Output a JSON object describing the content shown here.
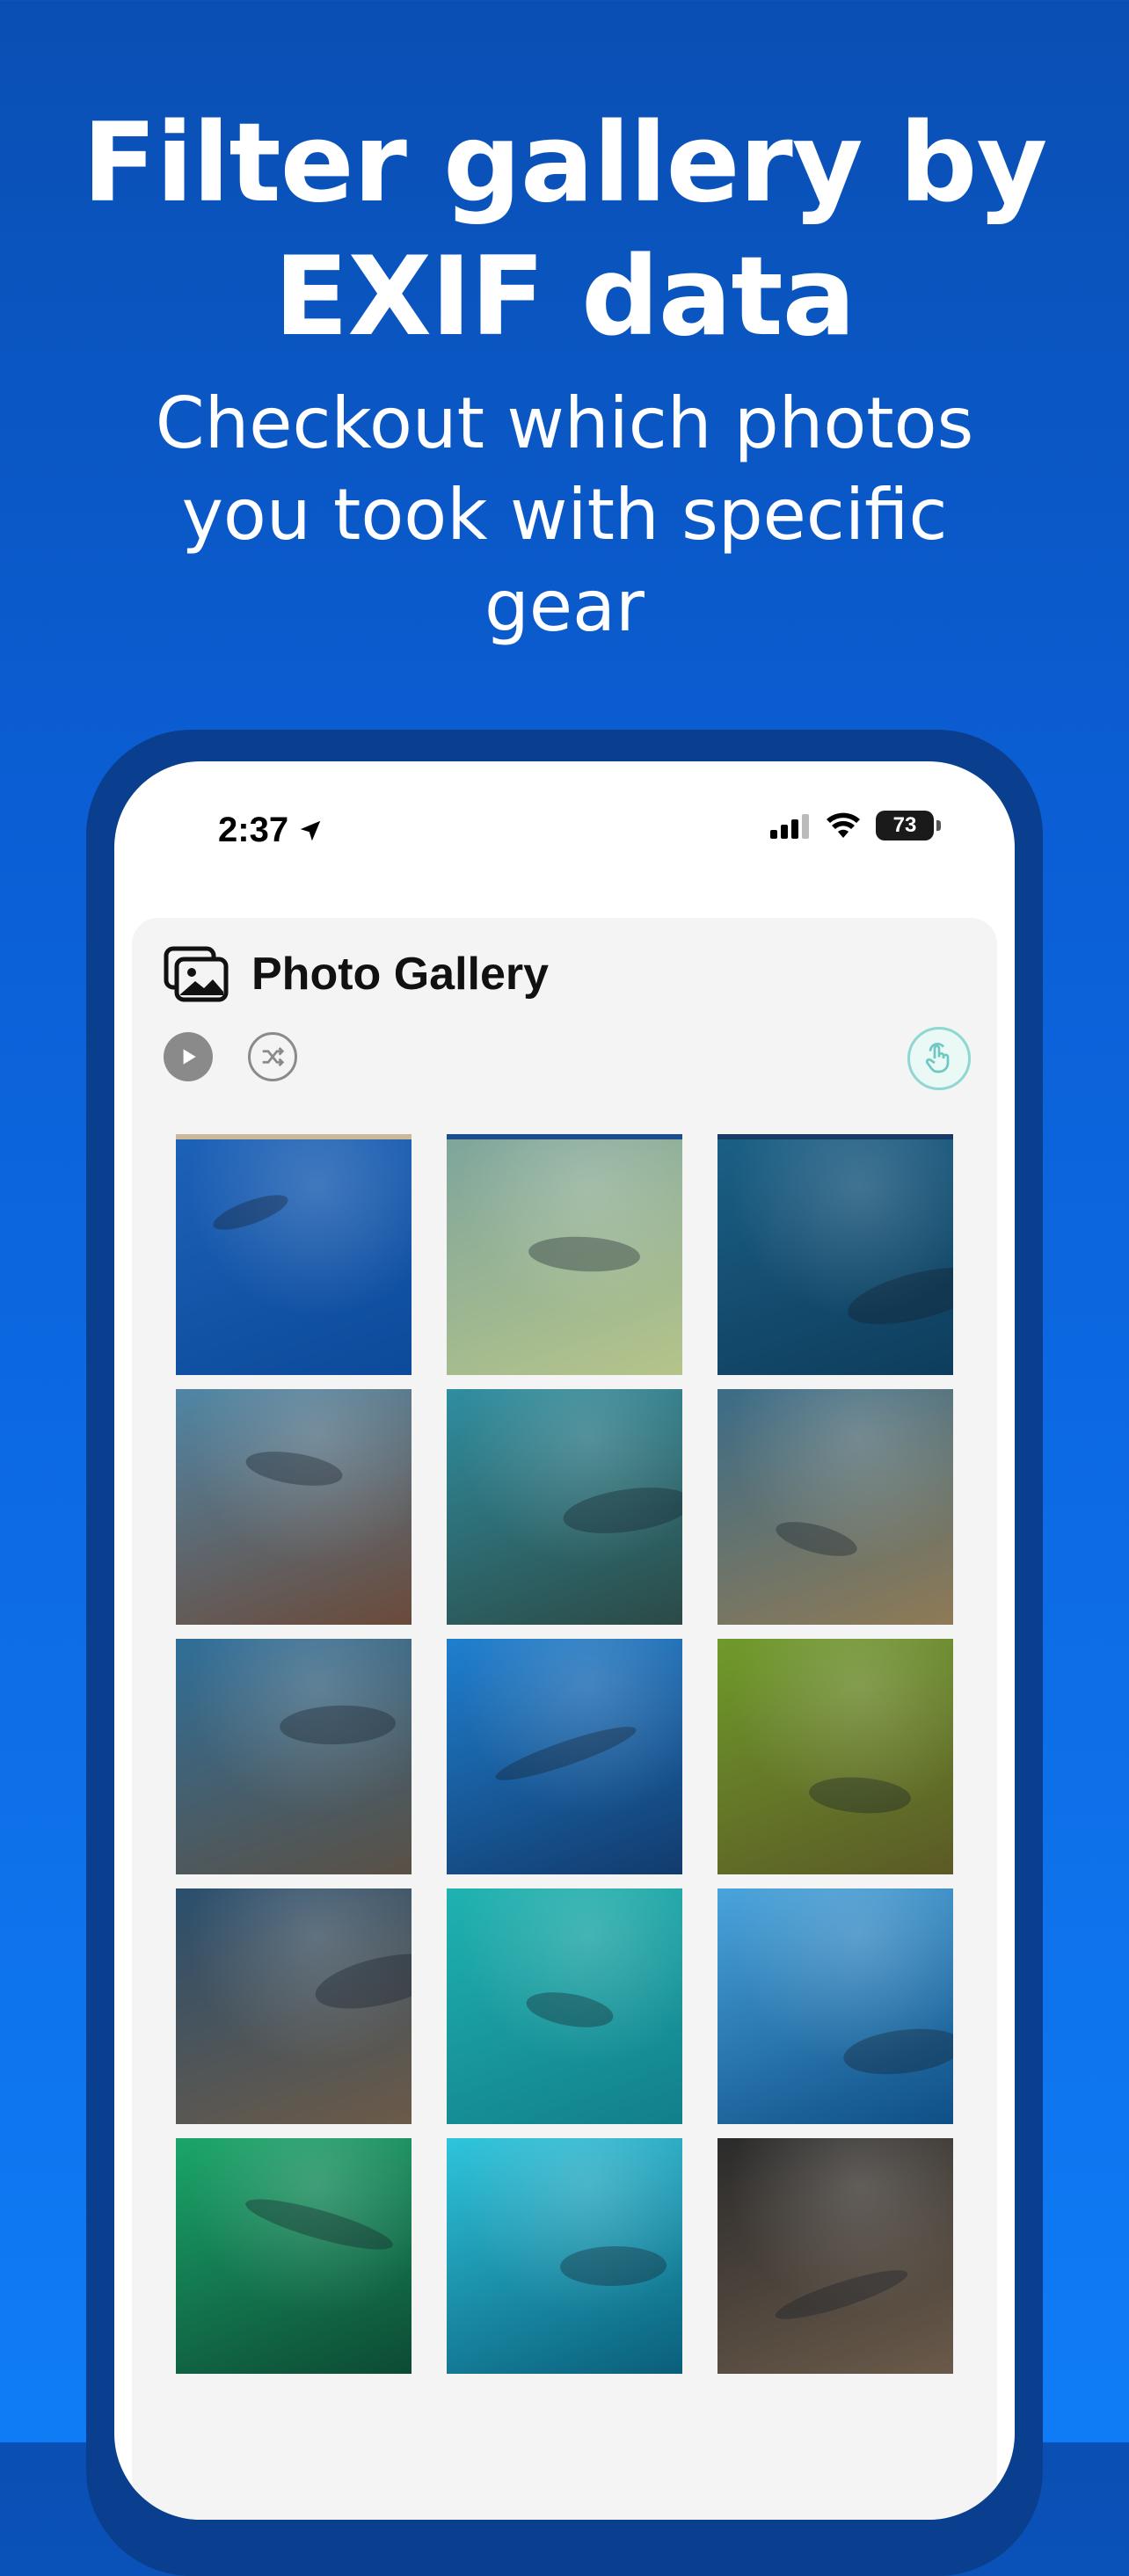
{
  "promo": {
    "headline_line1": "Filter gallery by",
    "headline_line2": "EXIF data",
    "subline_line1": "Checkout which photos",
    "subline_line2": "you took with specific",
    "subline_line3": "gear"
  },
  "status_bar": {
    "time": "2:37",
    "battery_level": "73",
    "icons": [
      "location-arrow-icon",
      "signal-icon",
      "wifi-icon",
      "battery-icon"
    ]
  },
  "gallery": {
    "title": "Photo Gallery",
    "title_icon": "photo-gallery-icon",
    "controls": {
      "play_icon": "play-icon",
      "shuffle_icon": "shuffle-icon",
      "touch_icon": "touch-select-icon"
    },
    "tiles": [
      {
        "id": "t1",
        "colors": [
          "#1d62b8",
          "#0c4a9a"
        ]
      },
      {
        "id": "t2",
        "colors": [
          "#7ea59c",
          "#b5c48a"
        ]
      },
      {
        "id": "t3",
        "colors": [
          "#1b5f86",
          "#0e3d5c"
        ]
      },
      {
        "id": "t4",
        "colors": [
          "#4f86a6",
          "#6b4a3a"
        ]
      },
      {
        "id": "t5",
        "colors": [
          "#2f8ea0",
          "#2c4a46"
        ]
      },
      {
        "id": "t6",
        "colors": [
          "#3b6c88",
          "#8f7a55"
        ]
      },
      {
        "id": "t7",
        "colors": [
          "#2f6f9a",
          "#5a5045"
        ]
      },
      {
        "id": "t8",
        "colors": [
          "#1f7fcf",
          "#123b6d"
        ]
      },
      {
        "id": "t9",
        "colors": [
          "#6f9a2a",
          "#5b5a26"
        ]
      },
      {
        "id": "t10",
        "colors": [
          "#2a4f6e",
          "#6b5a48"
        ]
      },
      {
        "id": "t11",
        "colors": [
          "#1fb3b0",
          "#127f8a"
        ]
      },
      {
        "id": "t12",
        "colors": [
          "#4aa4dc",
          "#0e4f86"
        ]
      },
      {
        "id": "t13",
        "colors": [
          "#1aa66a",
          "#0d4a34"
        ]
      },
      {
        "id": "t14",
        "colors": [
          "#2ec5dc",
          "#0a5e7a"
        ]
      },
      {
        "id": "t15",
        "colors": [
          "#2b2b2b",
          "#6a5a4a"
        ]
      }
    ]
  },
  "colors": {
    "accent_teal": "#8fd8d2",
    "frame_blue": "#0a3f8f"
  }
}
